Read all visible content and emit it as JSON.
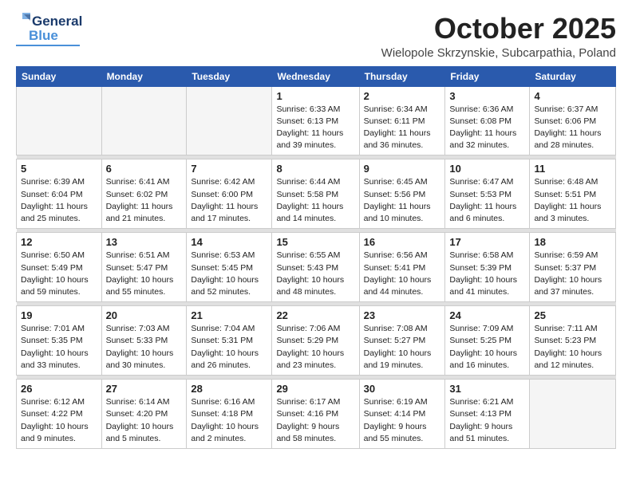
{
  "header": {
    "logo_general": "General",
    "logo_blue": "Blue",
    "month": "October 2025",
    "location": "Wielopole Skrzynskie, Subcarpathia, Poland"
  },
  "days_of_week": [
    "Sunday",
    "Monday",
    "Tuesday",
    "Wednesday",
    "Thursday",
    "Friday",
    "Saturday"
  ],
  "weeks": [
    [
      {
        "day": "",
        "empty": true
      },
      {
        "day": "",
        "empty": true
      },
      {
        "day": "",
        "empty": true
      },
      {
        "day": "1",
        "sunrise": "6:33 AM",
        "sunset": "6:13 PM",
        "daylight": "11 hours and 39 minutes."
      },
      {
        "day": "2",
        "sunrise": "6:34 AM",
        "sunset": "6:11 PM",
        "daylight": "11 hours and 36 minutes."
      },
      {
        "day": "3",
        "sunrise": "6:36 AM",
        "sunset": "6:08 PM",
        "daylight": "11 hours and 32 minutes."
      },
      {
        "day": "4",
        "sunrise": "6:37 AM",
        "sunset": "6:06 PM",
        "daylight": "11 hours and 28 minutes."
      }
    ],
    [
      {
        "day": "5",
        "sunrise": "6:39 AM",
        "sunset": "6:04 PM",
        "daylight": "11 hours and 25 minutes."
      },
      {
        "day": "6",
        "sunrise": "6:41 AM",
        "sunset": "6:02 PM",
        "daylight": "11 hours and 21 minutes."
      },
      {
        "day": "7",
        "sunrise": "6:42 AM",
        "sunset": "6:00 PM",
        "daylight": "11 hours and 17 minutes."
      },
      {
        "day": "8",
        "sunrise": "6:44 AM",
        "sunset": "5:58 PM",
        "daylight": "11 hours and 14 minutes."
      },
      {
        "day": "9",
        "sunrise": "6:45 AM",
        "sunset": "5:56 PM",
        "daylight": "11 hours and 10 minutes."
      },
      {
        "day": "10",
        "sunrise": "6:47 AM",
        "sunset": "5:53 PM",
        "daylight": "11 hours and 6 minutes."
      },
      {
        "day": "11",
        "sunrise": "6:48 AM",
        "sunset": "5:51 PM",
        "daylight": "11 hours and 3 minutes."
      }
    ],
    [
      {
        "day": "12",
        "sunrise": "6:50 AM",
        "sunset": "5:49 PM",
        "daylight": "10 hours and 59 minutes."
      },
      {
        "day": "13",
        "sunrise": "6:51 AM",
        "sunset": "5:47 PM",
        "daylight": "10 hours and 55 minutes."
      },
      {
        "day": "14",
        "sunrise": "6:53 AM",
        "sunset": "5:45 PM",
        "daylight": "10 hours and 52 minutes."
      },
      {
        "day": "15",
        "sunrise": "6:55 AM",
        "sunset": "5:43 PM",
        "daylight": "10 hours and 48 minutes."
      },
      {
        "day": "16",
        "sunrise": "6:56 AM",
        "sunset": "5:41 PM",
        "daylight": "10 hours and 44 minutes."
      },
      {
        "day": "17",
        "sunrise": "6:58 AM",
        "sunset": "5:39 PM",
        "daylight": "10 hours and 41 minutes."
      },
      {
        "day": "18",
        "sunrise": "6:59 AM",
        "sunset": "5:37 PM",
        "daylight": "10 hours and 37 minutes."
      }
    ],
    [
      {
        "day": "19",
        "sunrise": "7:01 AM",
        "sunset": "5:35 PM",
        "daylight": "10 hours and 33 minutes."
      },
      {
        "day": "20",
        "sunrise": "7:03 AM",
        "sunset": "5:33 PM",
        "daylight": "10 hours and 30 minutes."
      },
      {
        "day": "21",
        "sunrise": "7:04 AM",
        "sunset": "5:31 PM",
        "daylight": "10 hours and 26 minutes."
      },
      {
        "day": "22",
        "sunrise": "7:06 AM",
        "sunset": "5:29 PM",
        "daylight": "10 hours and 23 minutes."
      },
      {
        "day": "23",
        "sunrise": "7:08 AM",
        "sunset": "5:27 PM",
        "daylight": "10 hours and 19 minutes."
      },
      {
        "day": "24",
        "sunrise": "7:09 AM",
        "sunset": "5:25 PM",
        "daylight": "10 hours and 16 minutes."
      },
      {
        "day": "25",
        "sunrise": "7:11 AM",
        "sunset": "5:23 PM",
        "daylight": "10 hours and 12 minutes."
      }
    ],
    [
      {
        "day": "26",
        "sunrise": "6:12 AM",
        "sunset": "4:22 PM",
        "daylight": "10 hours and 9 minutes."
      },
      {
        "day": "27",
        "sunrise": "6:14 AM",
        "sunset": "4:20 PM",
        "daylight": "10 hours and 5 minutes."
      },
      {
        "day": "28",
        "sunrise": "6:16 AM",
        "sunset": "4:18 PM",
        "daylight": "10 hours and 2 minutes."
      },
      {
        "day": "29",
        "sunrise": "6:17 AM",
        "sunset": "4:16 PM",
        "daylight": "9 hours and 58 minutes."
      },
      {
        "day": "30",
        "sunrise": "6:19 AM",
        "sunset": "4:14 PM",
        "daylight": "9 hours and 55 minutes."
      },
      {
        "day": "31",
        "sunrise": "6:21 AM",
        "sunset": "4:13 PM",
        "daylight": "9 hours and 51 minutes."
      },
      {
        "day": "",
        "empty": true
      }
    ]
  ]
}
